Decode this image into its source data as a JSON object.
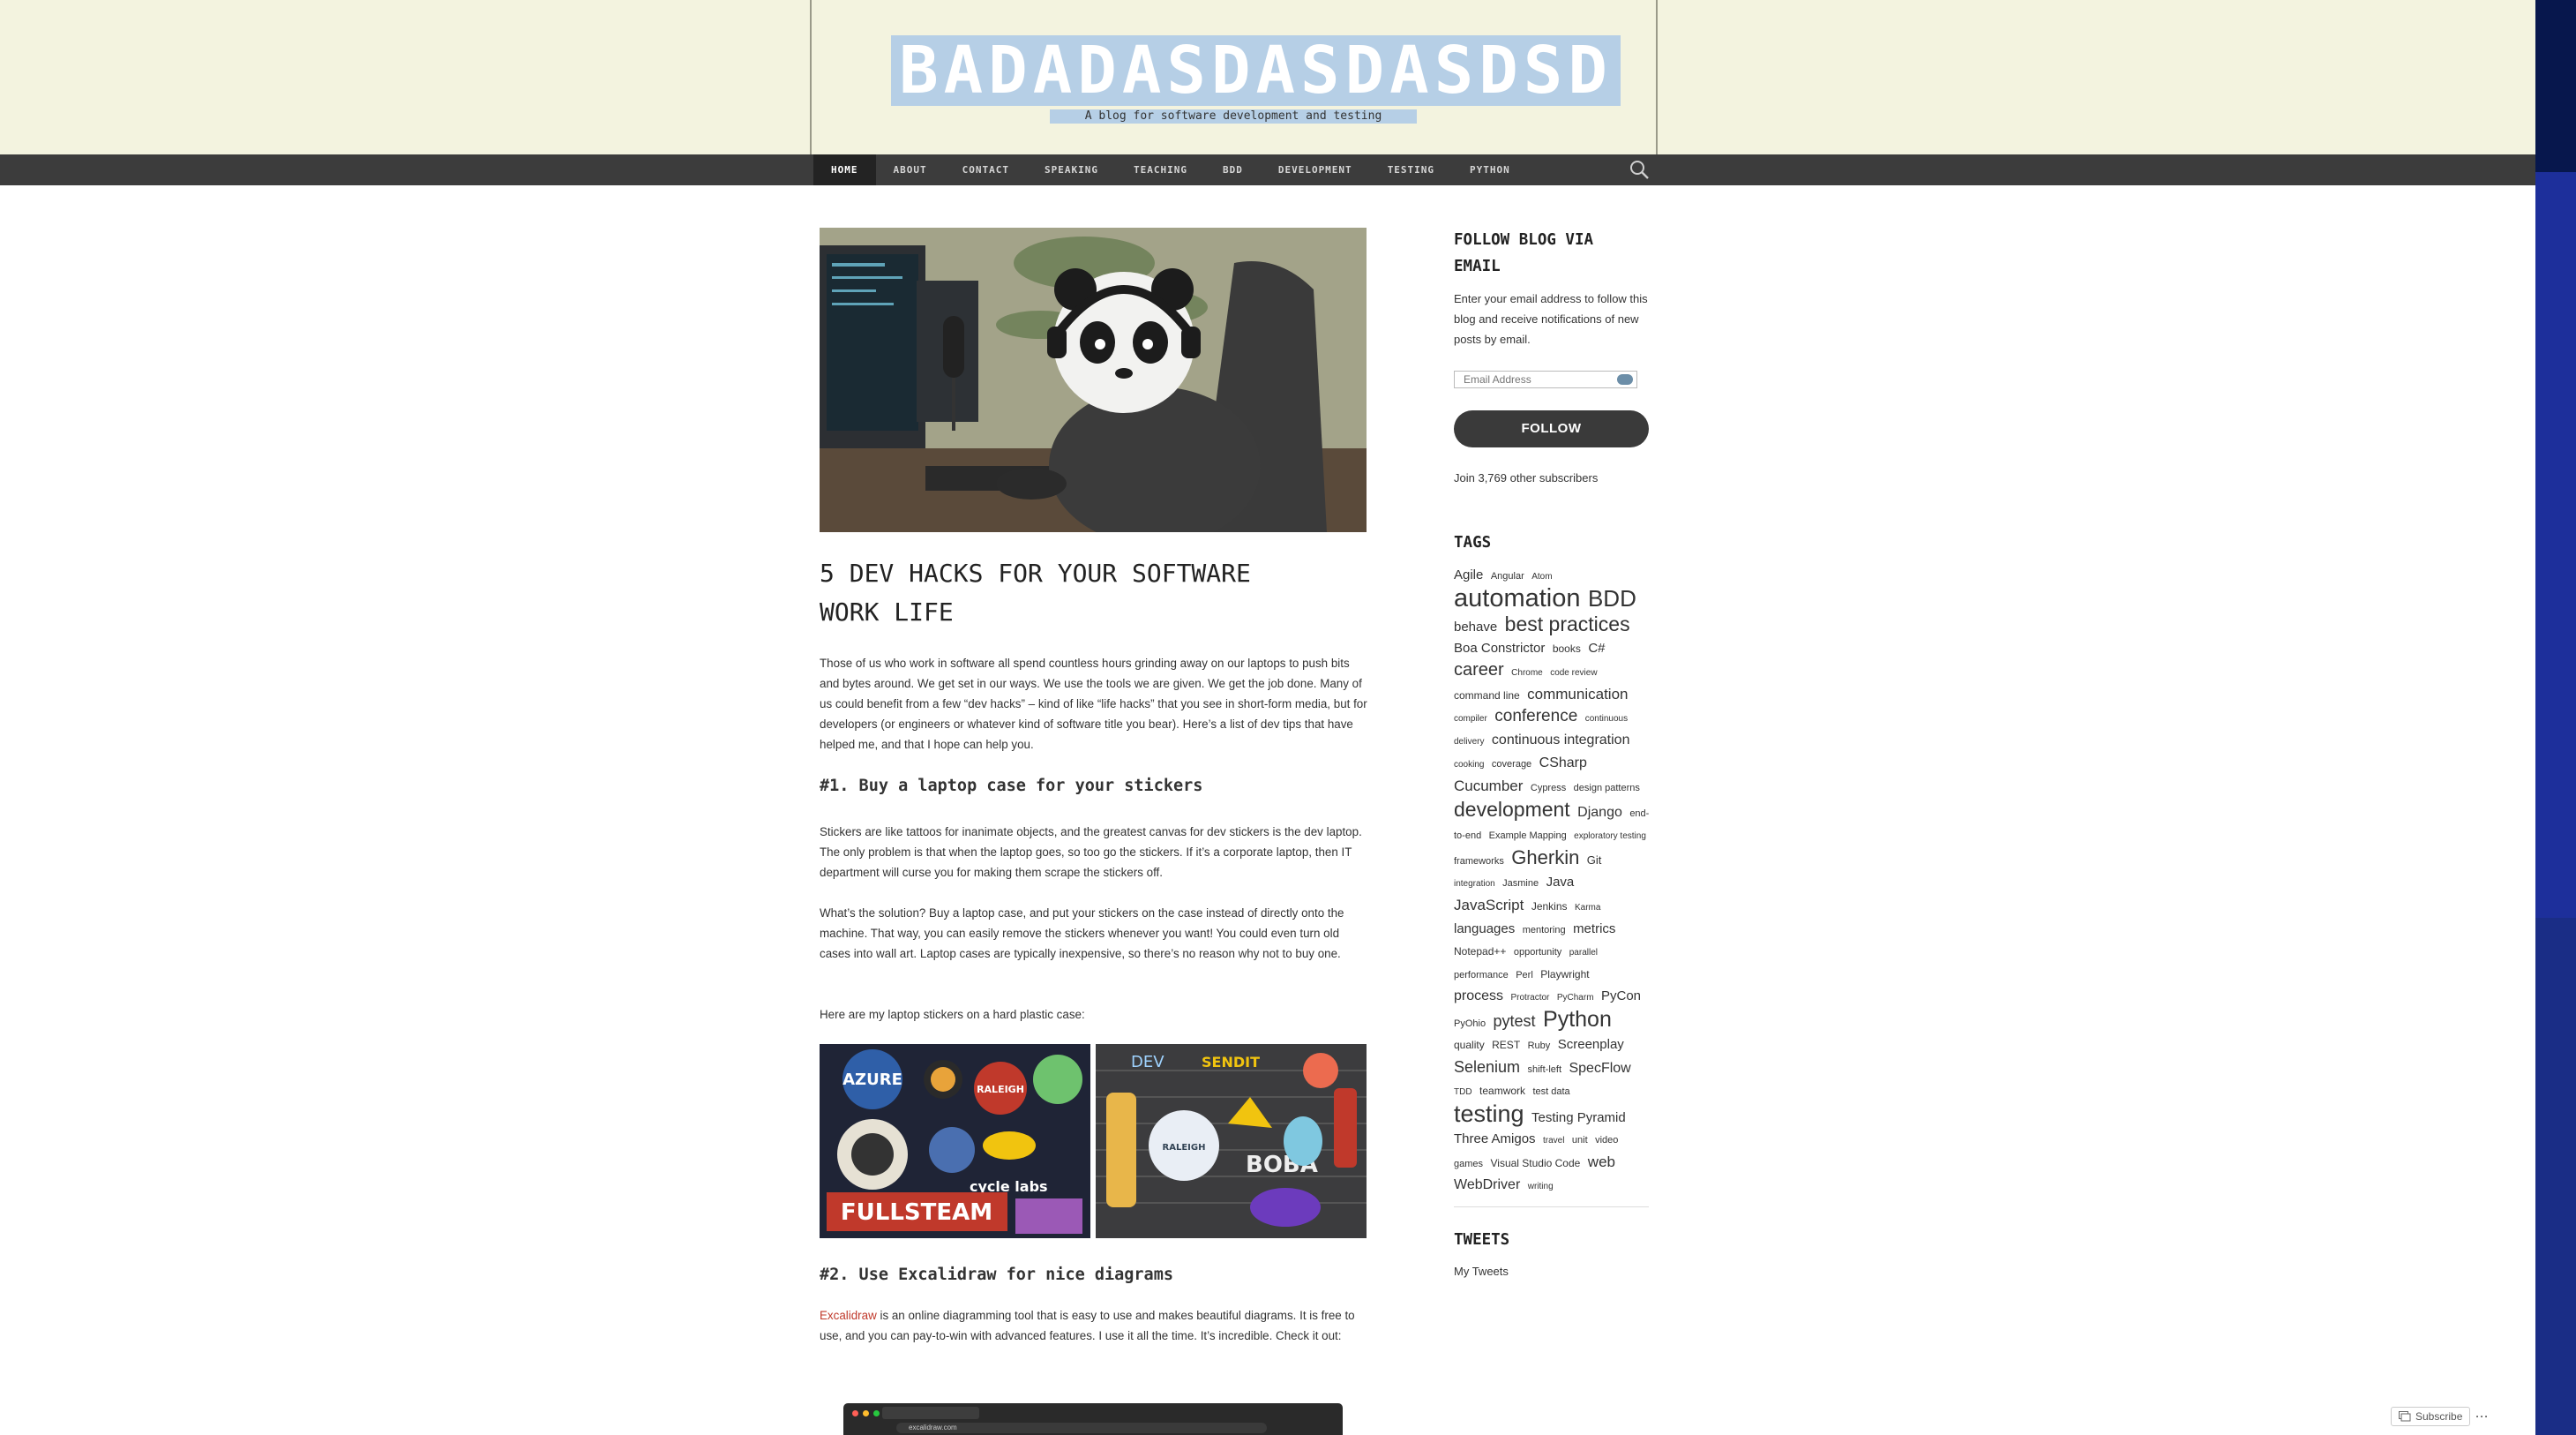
{
  "site": {
    "title": "BADADASDASDASDSD",
    "tagline": "A blog for software development and testing"
  },
  "nav": {
    "items": [
      "HOME",
      "ABOUT",
      "CONTACT",
      "SPEAKING",
      "TEACHING",
      "BDD",
      "DEVELOPMENT",
      "TESTING",
      "PYTHON"
    ],
    "active": "HOME",
    "search_icon": "search-icon"
  },
  "post": {
    "title": "5 DEV HACKS FOR YOUR SOFTWARE WORK LIFE",
    "intro": "Those of us who work in software all spend countless hours grinding away on our laptops to push bits and bytes around. We get set in our ways. We use the tools we are given. We get the job done. Many of us could benefit from a few “dev hacks” – kind of like “life hacks” that you see in short-form media, but for developers (or engineers or whatever kind of software title you bear). Here’s a list of dev tips that have helped me, and that I hope can help you.",
    "section1_heading": "#1. Buy a laptop case for your stickers",
    "section1_p1": "Stickers are like tattoos for inanimate objects, and the greatest canvas for dev stickers is the dev laptop. The only problem is that when the laptop goes, so too go the stickers. If it’s a corporate laptop, then IT department will curse you for making them scrape the stickers off.",
    "section1_p2": "What’s the solution? Buy a laptop case, and put your stickers on the case instead of directly onto the machine. That way, you can easily remove the stickers whenever you want! You could even turn old cases into wall art. Laptop cases are typically inexpensive, so there’s no reason why not to buy one.",
    "section1_p3": "Here are my laptop stickers on a hard plastic case:",
    "sticker1_texts": [
      "AZURE",
      "RALEIGH",
      "cycle labs",
      "FULLSTEAM"
    ],
    "sticker2_texts": [
      "DEV",
      "SENDIT",
      "RALEIGH",
      "BOBA"
    ],
    "section2_heading": "#2. Use Excalidraw for nice diagrams",
    "section2_link": "Excalidraw",
    "section2_text": " is an online diagramming tool that is easy to use and makes beautiful diagrams. It is free to use, and you can pay-to-win with advanced features. I use it all the time. It’s incredible. Check it out:",
    "screenshot_url": "excalidraw.com"
  },
  "sidebar": {
    "follow_title": "FOLLOW BLOG VIA EMAIL",
    "follow_text": "Enter your email address to follow this blog and receive notifications of new posts by email.",
    "email_placeholder": "Email Address",
    "follow_button": "FOLLOW",
    "subscribers": "Join 3,769 other subscribers",
    "tags_title": "TAGS",
    "tweets_title": "TWEETS",
    "tweets_link": "My Tweets",
    "tags": [
      {
        "t": "Agile",
        "s": 15
      },
      {
        "t": "Angular",
        "s": 11
      },
      {
        "t": "Atom",
        "s": 10
      },
      {
        "t": "automation",
        "s": 29
      },
      {
        "t": "BDD",
        "s": 26
      },
      {
        "t": "behave",
        "s": 15
      },
      {
        "t": "best practices",
        "s": 23
      },
      {
        "t": "Boa Constrictor",
        "s": 15
      },
      {
        "t": "books",
        "s": 12
      },
      {
        "t": "C#",
        "s": 15
      },
      {
        "t": "career",
        "s": 20
      },
      {
        "t": "Chrome",
        "s": 10
      },
      {
        "t": "code review",
        "s": 10
      },
      {
        "t": "command line",
        "s": 12
      },
      {
        "t": "communication",
        "s": 17
      },
      {
        "t": "compiler",
        "s": 10
      },
      {
        "t": "conference",
        "s": 19
      },
      {
        "t": "continuous delivery",
        "s": 10
      },
      {
        "t": "continuous integration",
        "s": 16
      },
      {
        "t": "cooking",
        "s": 10
      },
      {
        "t": "coverage",
        "s": 11
      },
      {
        "t": "CSharp",
        "s": 16
      },
      {
        "t": "Cucumber",
        "s": 17
      },
      {
        "t": "Cypress",
        "s": 11
      },
      {
        "t": "design patterns",
        "s": 11
      },
      {
        "t": "development",
        "s": 23
      },
      {
        "t": "Django",
        "s": 16
      },
      {
        "t": "end-to-end",
        "s": 11
      },
      {
        "t": "Example Mapping",
        "s": 11
      },
      {
        "t": "exploratory testing",
        "s": 10
      },
      {
        "t": "frameworks",
        "s": 11
      },
      {
        "t": "Gherkin",
        "s": 22
      },
      {
        "t": "Git",
        "s": 13
      },
      {
        "t": "integration",
        "s": 10
      },
      {
        "t": "Jasmine",
        "s": 11
      },
      {
        "t": "Java",
        "s": 15
      },
      {
        "t": "JavaScript",
        "s": 17
      },
      {
        "t": "Jenkins",
        "s": 12
      },
      {
        "t": "Karma",
        "s": 10
      },
      {
        "t": "languages",
        "s": 15
      },
      {
        "t": "mentoring",
        "s": 11
      },
      {
        "t": "metrics",
        "s": 15
      },
      {
        "t": "Notepad++",
        "s": 12
      },
      {
        "t": "opportunity",
        "s": 11
      },
      {
        "t": "parallel",
        "s": 10
      },
      {
        "t": "performance",
        "s": 11
      },
      {
        "t": "Perl",
        "s": 11
      },
      {
        "t": "Playwright",
        "s": 12
      },
      {
        "t": "process",
        "s": 16
      },
      {
        "t": "Protractor",
        "s": 10
      },
      {
        "t": "PyCharm",
        "s": 10
      },
      {
        "t": "PyCon",
        "s": 15
      },
      {
        "t": "PyOhio",
        "s": 11
      },
      {
        "t": "pytest",
        "s": 18
      },
      {
        "t": "Python",
        "s": 25
      },
      {
        "t": "quality",
        "s": 12
      },
      {
        "t": "REST",
        "s": 12
      },
      {
        "t": "Ruby",
        "s": 11
      },
      {
        "t": "Screenplay",
        "s": 15
      },
      {
        "t": "Selenium",
        "s": 18
      },
      {
        "t": "shift-left",
        "s": 11
      },
      {
        "t": "SpecFlow",
        "s": 16
      },
      {
        "t": "TDD",
        "s": 10
      },
      {
        "t": "teamwork",
        "s": 12
      },
      {
        "t": "test data",
        "s": 11
      },
      {
        "t": "testing",
        "s": 27
      },
      {
        "t": "Testing Pyramid",
        "s": 15
      },
      {
        "t": "Three Amigos",
        "s": 15
      },
      {
        "t": "travel",
        "s": 10
      },
      {
        "t": "unit",
        "s": 11
      },
      {
        "t": "video games",
        "s": 11
      },
      {
        "t": "Visual Studio Code",
        "s": 12
      },
      {
        "t": "web",
        "s": 17
      },
      {
        "t": "WebDriver",
        "s": 16
      },
      {
        "t": "writing",
        "s": 10
      }
    ]
  },
  "footer": {
    "subscribe": "Subscribe",
    "more": "···"
  },
  "colors": {
    "header_bg": "#f3f3df",
    "nav_bg": "#3c3c3c",
    "link": "#c0392b",
    "title_highlight": "#b6cfe6"
  }
}
